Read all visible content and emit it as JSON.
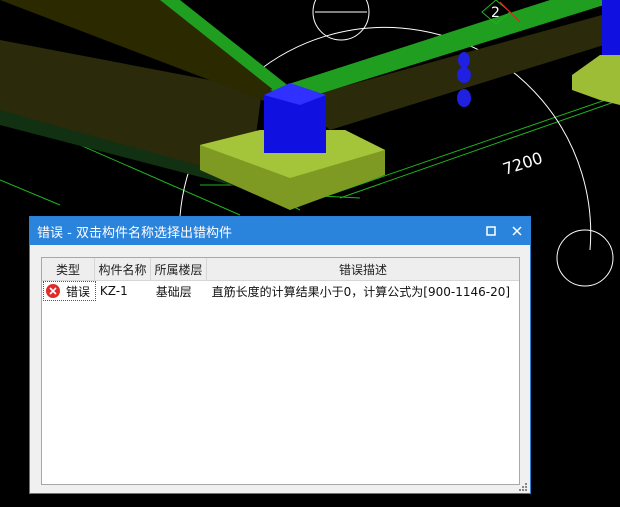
{
  "scene": {
    "dimension_label": "7200",
    "axis_label": "2",
    "colors": {
      "background": "#000000",
      "beam_top": "#1f9e1f",
      "beam_side": "#2b2a0a",
      "column": "#1010e0",
      "footing": "#8faa2a",
      "grid_line": "#1fb41f"
    }
  },
  "dialog": {
    "title": "错误 - 双击构件名称选择出错构件",
    "maximize_icon": "maximize-icon",
    "close_icon": "close-icon",
    "columns": [
      "类型",
      "构件名称",
      "所属楼层",
      "错误描述"
    ],
    "rows": [
      {
        "type": "错误",
        "type_icon": "error-icon",
        "name": "KZ-1",
        "floor": "基础层",
        "description": "直筋长度的计算结果小于0，计算公式为[900-1146-20]"
      }
    ],
    "colors": {
      "titlebar": "#2b84dc",
      "error": "#e02b2b"
    }
  }
}
